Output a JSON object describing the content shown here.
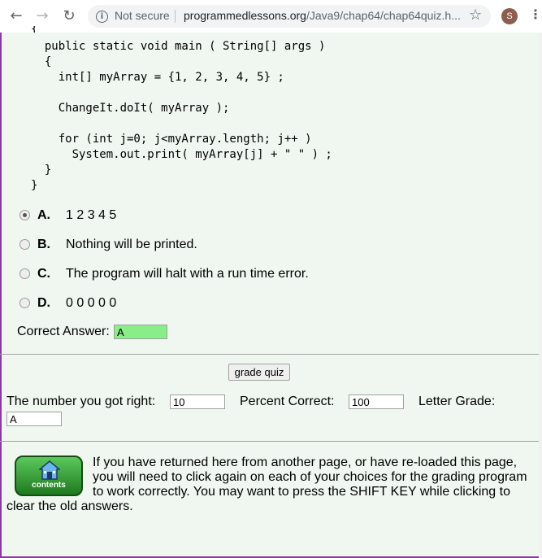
{
  "browser": {
    "back_icon": "back-arrow-icon",
    "forward_icon": "forward-arrow-icon",
    "reload_icon": "reload-icon",
    "security_label": "Not secure",
    "url_host": "programmedlessons.org",
    "url_path": "/Java9/chap64/chap64quiz.h...",
    "avatar_letter": "S"
  },
  "code_lines": [
    "  public static void main ( String[] args )",
    "  {",
    "    int[] myArray = {1, 2, 3, 4, 5} ;",
    "",
    "    ChangeIt.doIt( myArray );",
    "",
    "    for (int j=0; j<myArray.length; j++ )",
    "      System.out.print( myArray[j] + \" \" ) ;",
    "  }",
    "}"
  ],
  "choices": [
    {
      "letter": "A.",
      "text": "1 2 3 4 5",
      "selected": true
    },
    {
      "letter": "B.",
      "text": "Nothing will be printed.",
      "selected": false
    },
    {
      "letter": "C.",
      "text": "The program will halt with a run time error.",
      "selected": false
    },
    {
      "letter": "D.",
      "text": "0 0 0 0 0",
      "selected": false
    }
  ],
  "answer": {
    "label": "Correct Answer:",
    "value": "A",
    "highlight_color": "#88ee88"
  },
  "grading": {
    "button_label": "grade quiz",
    "right_label": "The number you got right:",
    "right_value": "10",
    "percent_label": "Percent Correct:",
    "percent_value": "100",
    "grade_label": "Letter Grade:",
    "grade_value": "A"
  },
  "footer": {
    "contents_label": "contents",
    "contents_icon": "house-icon",
    "note": "If you have returned here from another page, or have re-loaded this page, you will need to click again on each of your choices for the grading program to work correctly. You may want to press the SHIFT KEY while clicking to clear the old answers."
  },
  "colors": {
    "page_bg": "#f0f7f0",
    "frame_border": "#8b3aa5",
    "button_green": "#3aa83a"
  }
}
